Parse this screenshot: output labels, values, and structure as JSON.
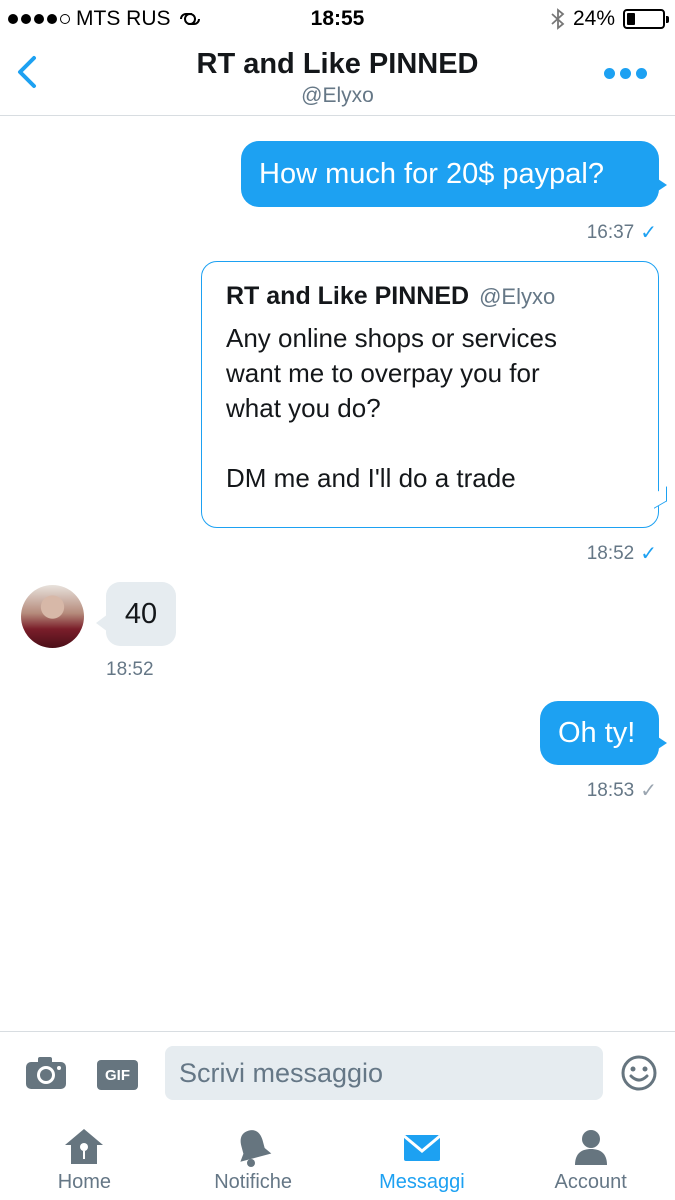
{
  "status_bar": {
    "carrier": "MTS RUS",
    "time": "18:55",
    "battery": "24%",
    "battery_level": 0.24
  },
  "header": {
    "title": "RT and Like PINNED",
    "subtitle": "@Elyxo"
  },
  "messages": [
    {
      "direction": "outgoing",
      "text": "How much for 20$ paypal?",
      "time": "16:37",
      "status": "sent"
    },
    {
      "direction": "outgoing",
      "type": "tweet",
      "tweet": {
        "author": "RT and Like PINNED",
        "handle": "@Elyxo",
        "text": "Any online shops or services\nwant me to overpay you for\nwhat you do?\n\nDM me and I'll do a trade"
      },
      "time": "18:52",
      "status": "sent"
    },
    {
      "direction": "incoming",
      "text": "40",
      "time": "18:52"
    },
    {
      "direction": "outgoing",
      "text": "Oh ty!",
      "time": "18:53",
      "status": "delivered"
    }
  ],
  "composer": {
    "gif_label": "GIF",
    "placeholder": "Scrivi messaggio"
  },
  "tabs": [
    {
      "label": "Home",
      "icon": "home-icon",
      "active": false
    },
    {
      "label": "Notifiche",
      "icon": "bell-icon",
      "active": false
    },
    {
      "label": "Messaggi",
      "icon": "envelope-icon",
      "active": true
    },
    {
      "label": "Account",
      "icon": "person-icon",
      "active": false
    }
  ],
  "colors": {
    "accent": "#1da1f2",
    "incoming_bubble": "#e6ecf0",
    "secondary_text": "#657786",
    "icon_grey": "#66757f"
  }
}
